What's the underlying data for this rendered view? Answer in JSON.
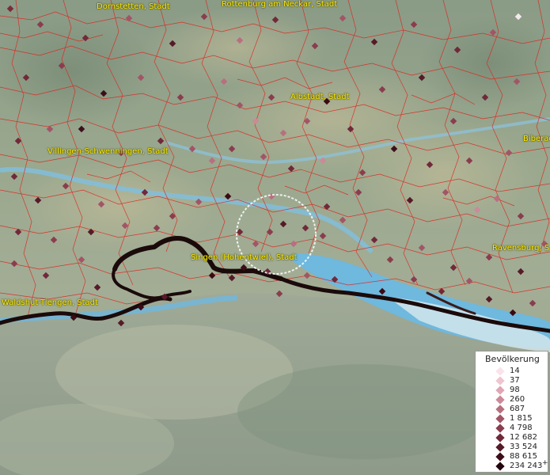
{
  "map": {
    "city_labels": [
      {
        "id": "dornstetten",
        "text": "Dornstetten, Stadt"
      },
      {
        "id": "rottenburg",
        "text": "Rottenburg am Neckar, Stadt"
      },
      {
        "id": "albstadt",
        "text": "Albstadt, Stadt"
      },
      {
        "id": "villingen",
        "text": "Villingen-Schwenningen, Stadt"
      },
      {
        "id": "biberach",
        "text": "Biberac"
      },
      {
        "id": "singen",
        "text": "Singen (Hohentwiel), Stadt"
      },
      {
        "id": "ravensburg",
        "text": "Ravensburg, S"
      },
      {
        "id": "waldshut",
        "text": "Waldshut-Tiengen, Stadt"
      }
    ],
    "colors": {
      "district_border": "#e0201a",
      "national_border": "#1a0a0a",
      "water": "#6fb8de",
      "label_text": "#ffee00",
      "marker_dark": "#3b0a12",
      "marker_mid": "#7a2b3a",
      "marker_light": "#c88a98"
    }
  },
  "legend": {
    "title": "Bevölkerung",
    "items": [
      {
        "value": "14",
        "color": "#fbe3ea"
      },
      {
        "value": "37",
        "color": "#f0c4d0"
      },
      {
        "value": "98",
        "color": "#dfa7b5"
      },
      {
        "value": "260",
        "color": "#cc8999"
      },
      {
        "value": "687",
        "color": "#b86f80"
      },
      {
        "value": "1 815",
        "color": "#a25566"
      },
      {
        "value": "4 798",
        "color": "#8a3d4e"
      },
      {
        "value": "12 682",
        "color": "#70293a"
      },
      {
        "value": "33 524",
        "color": "#561a28"
      },
      {
        "value": "88 615",
        "color": "#3d0e1a"
      },
      {
        "value": "234 243",
        "color": "#22050c"
      }
    ],
    "plus_sign": "+"
  }
}
